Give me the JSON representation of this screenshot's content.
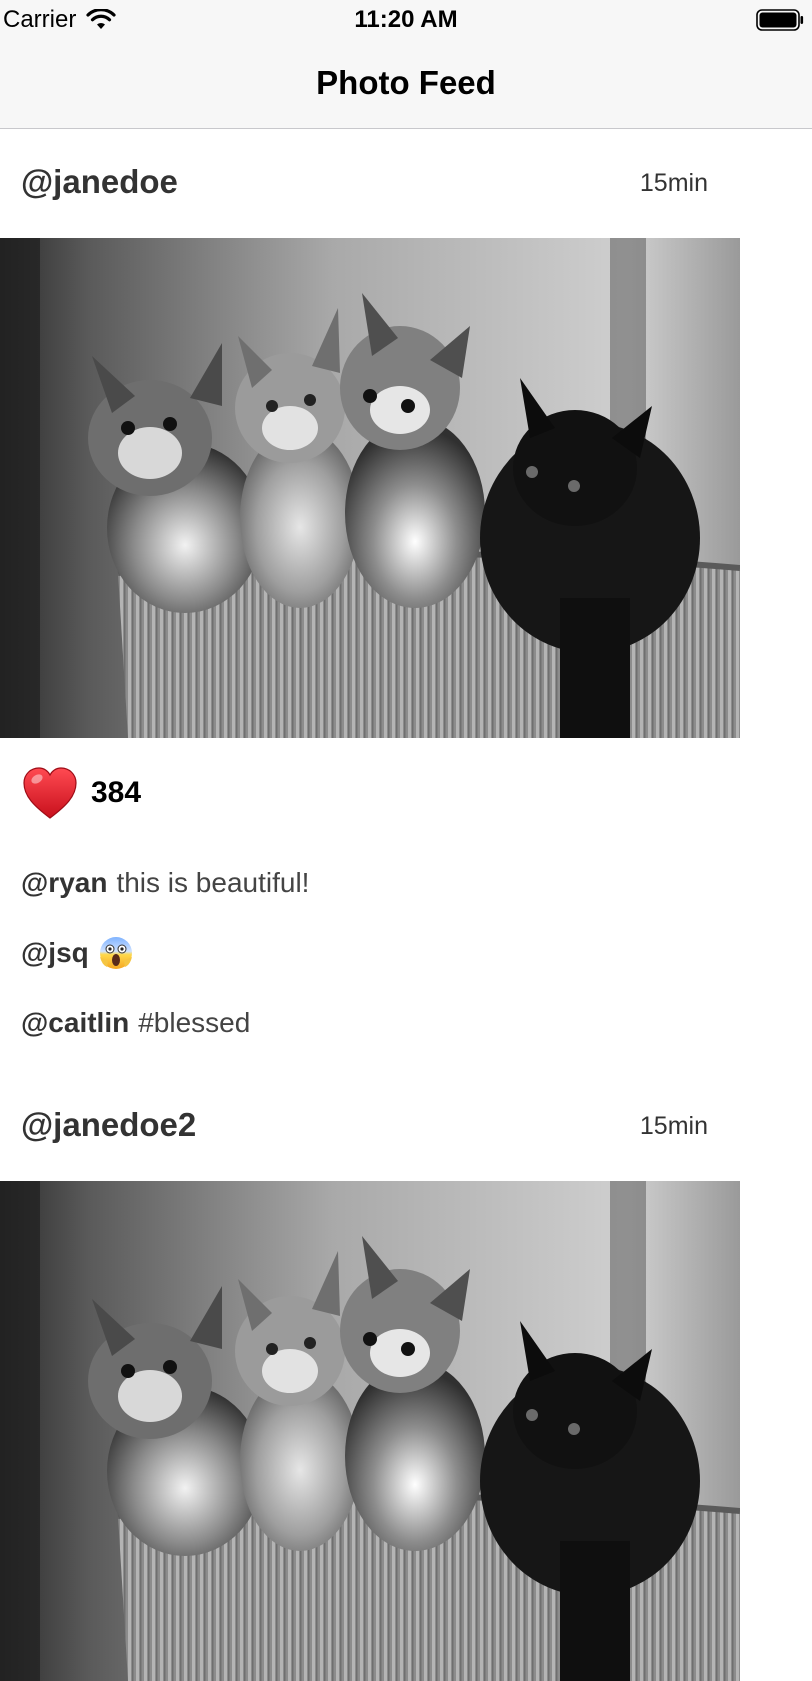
{
  "status_bar": {
    "carrier": "Carrier",
    "time": "11:20 AM",
    "wifi_icon": "wifi-icon",
    "battery_icon": "battery-icon"
  },
  "nav": {
    "title": "Photo Feed"
  },
  "posts": [
    {
      "username": "@janedoe",
      "time_ago": "15min",
      "photo_icon": "kittens-photo",
      "like_icon": "heart-icon",
      "likes": "384",
      "comments": [
        {
          "user": "@ryan",
          "text": "this is beautiful!"
        },
        {
          "user": "@jsq",
          "text": "",
          "emoji_icon": "scream-emoji-icon"
        },
        {
          "user": "@caitlin",
          "text": "#blessed"
        }
      ]
    },
    {
      "username": "@janedoe2",
      "time_ago": "15min",
      "photo_icon": "kittens-photo"
    }
  ],
  "colors": {
    "bar_background": "#f7f7f7",
    "separator": "#c8c8cc",
    "text_primary": "#333333",
    "heart": "#e8202a"
  }
}
